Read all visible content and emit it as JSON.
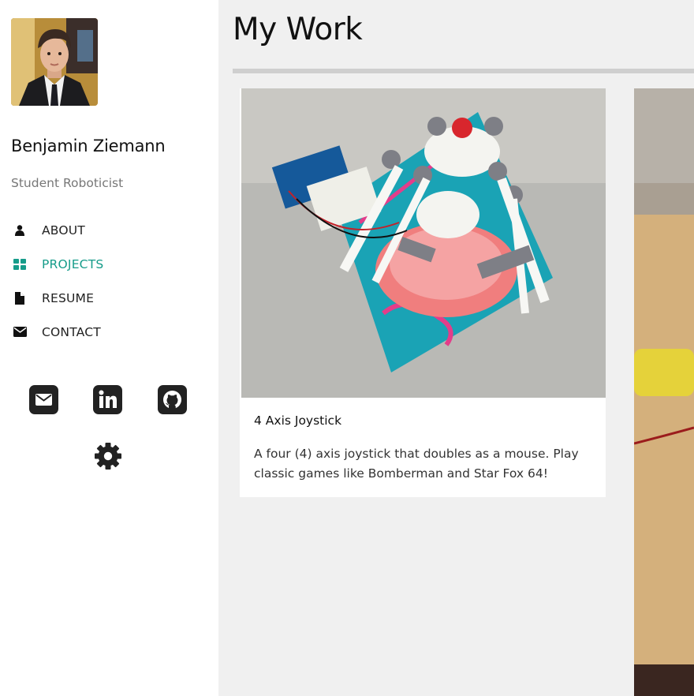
{
  "profile": {
    "name": "Benjamin Ziemann",
    "subtitle": "Student Roboticist"
  },
  "nav": {
    "items": [
      {
        "label": "ABOUT",
        "icon": "user-icon"
      },
      {
        "label": "PROJECTS",
        "icon": "grid-icon",
        "active": true
      },
      {
        "label": "RESUME",
        "icon": "file-icon"
      },
      {
        "label": "CONTACT",
        "icon": "envelope-icon"
      }
    ]
  },
  "social": {
    "icons": [
      "email-icon",
      "linkedin-icon",
      "github-icon"
    ],
    "settings_icon": "gear-icon"
  },
  "main": {
    "title": "My Work",
    "projects": [
      {
        "title": "4 Axis Joystick",
        "description": "A four (4) axis joystick that doubles as a mouse. Play classic games like Bomberman and Star Fox 64!"
      }
    ]
  },
  "colors": {
    "accent": "#169c8a",
    "sidebar_bg": "#ffffff",
    "main_bg": "#f0f0f0",
    "rule": "#cfcfcf"
  }
}
